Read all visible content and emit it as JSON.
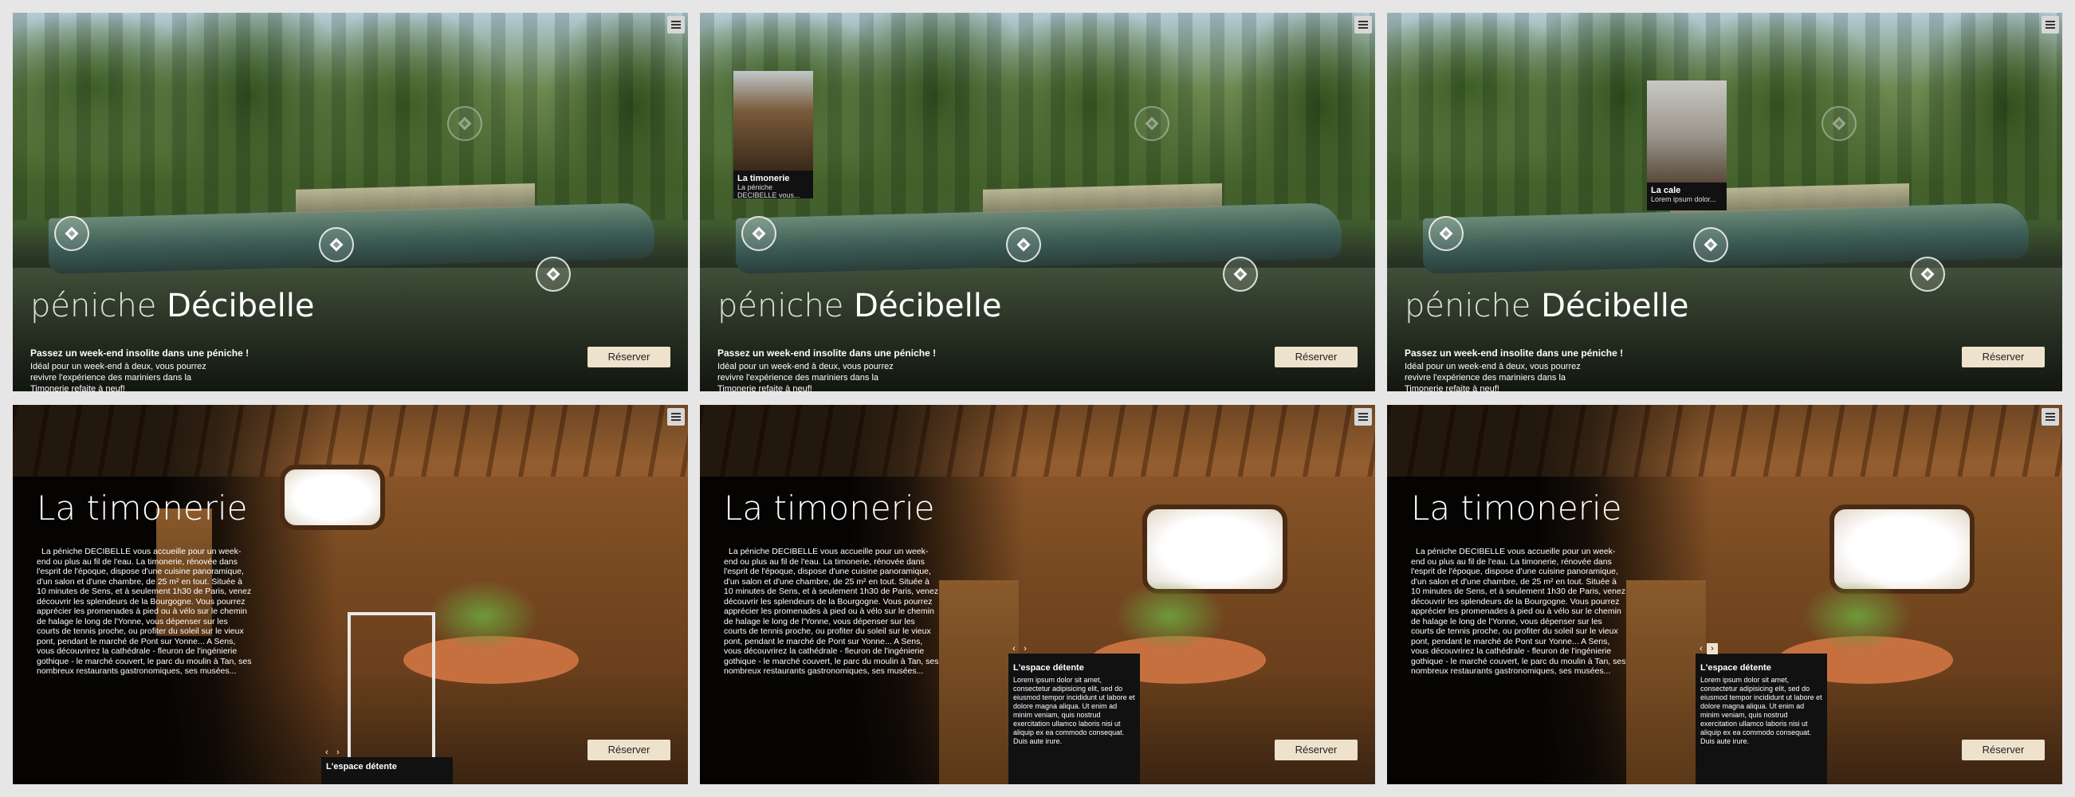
{
  "exterior": {
    "title_light": "péniche",
    "title_bold": "Décibelle",
    "subtitle": "Passez un week-end insolite dans une péniche !",
    "description": "Idéal pour un week-end à deux, vous pourrez revivre l'expérience des mariniers dans la Timonerie refaite à neuf!",
    "reserve_label": "Réserver",
    "popups": {
      "timonerie": {
        "title": "La timonerie",
        "text": "La péniche DECIBELLE vous..."
      },
      "cale": {
        "title": "La cale",
        "text": "Lorem ipsum dolor..."
      }
    }
  },
  "interior": {
    "title": "La timonerie",
    "text": "La péniche DECIBELLE vous accueille pour un week-end ou plus au fil de l'eau. La timonerie, rénovée dans l'esprit de l'époque, dispose d'une cuisine panoramique, d'un salon et d'une chambre, de 25 m² en tout. Située à 10 minutes de Sens, et à seulement 1h30 de Paris, venez découvrir les splendeurs de la Bourgogne. Vous pourrez apprécier les promenades à pied ou à vélo sur le chemin de halage le long de l'Yonne, vous dépenser sur les courts de tennis proche, ou profiter du soleil sur le vieux pont, pendant le marché de Pont sur Yonne... A Sens, vous découvrirez la cathédrale - fleuron de l'ingénierie gothique - le marché couvert, le parc du moulin à Tan, ses nombreux restaurants gastronomiques, ses musées...",
    "reserve_label": "Réserver",
    "carousel": {
      "title": "L'espace détente",
      "text": "Lorem ipsum dolor sit amet, consectetur adipisicing elit, sed do eiusmod tempor incididunt ut labore et dolore magna aliqua. Ut enim ad minim veniam, quis nostrud exercitation ullamco laboris nisi ut aliquip ex ea commodo consequat. Duis aute irure.",
      "prev": "‹",
      "next": "›"
    }
  },
  "icons": {
    "menu": "hamburger-menu-icon",
    "hotspot": "diamond-hotspot-icon"
  },
  "colors": {
    "reserve_bg": "#efe2cc",
    "background": "#e6e6e6",
    "popup_bg": "#111111"
  }
}
